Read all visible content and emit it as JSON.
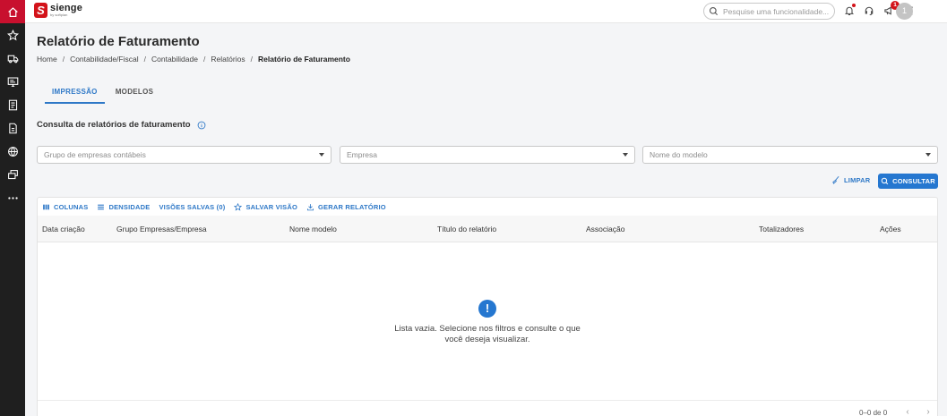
{
  "rail": {
    "items": [
      {
        "icon": "home-icon",
        "active": true
      },
      {
        "icon": "star-icon"
      },
      {
        "icon": "truck-icon"
      },
      {
        "icon": "monitor-icon"
      },
      {
        "icon": "document-list-icon"
      },
      {
        "icon": "invoice-icon"
      },
      {
        "icon": "globe-icon"
      },
      {
        "icon": "layers-icon"
      },
      {
        "icon": "more-icon"
      }
    ]
  },
  "topbar": {
    "logo_name": "sienge",
    "logo_sub": "by softplan",
    "search_placeholder": "Pesquise uma funcionalidade...",
    "notification_count": "1",
    "avatar_initial": "1"
  },
  "page": {
    "title": "Relatório de Faturamento",
    "breadcrumb": [
      "Home",
      "Contabilidade/Fiscal",
      "Contabilidade",
      "Relatórios",
      "Relatório de Faturamento"
    ]
  },
  "tabs": [
    {
      "label": "IMPRESSÃO",
      "active": true
    },
    {
      "label": "MODELOS",
      "active": false
    }
  ],
  "section_title": "Consulta de relatórios de faturamento",
  "filters": {
    "group_placeholder": "Grupo de empresas contábeis",
    "company_placeholder": "Empresa",
    "model_placeholder": "Nome do modelo"
  },
  "actions": {
    "clear_label": "LIMPAR",
    "query_label": "CONSULTAR"
  },
  "grid": {
    "toolbar": {
      "columns_label": "COLUNAS",
      "density_label": "DENSIDADE",
      "saved_views_label": "VISÕES SALVAS (0)",
      "save_view_label": "SALVAR VISÃO",
      "generate_label": "GERAR RELATÓRIO"
    },
    "columns": [
      "Data criação",
      "Grupo Empresas/Empresa",
      "Nome modelo",
      "Título do relatório",
      "Associação",
      "Totalizadores",
      "Ações"
    ],
    "empty_icon": "!",
    "empty_message": "Lista vazia. Selecione nos filtros e consulte o que você deseja visualizar.",
    "pagination": "0–0 de 0"
  },
  "colors": {
    "brand_red": "#d3131a",
    "rail_bg": "#1f1f1f",
    "primary_blue": "#2577d0"
  }
}
